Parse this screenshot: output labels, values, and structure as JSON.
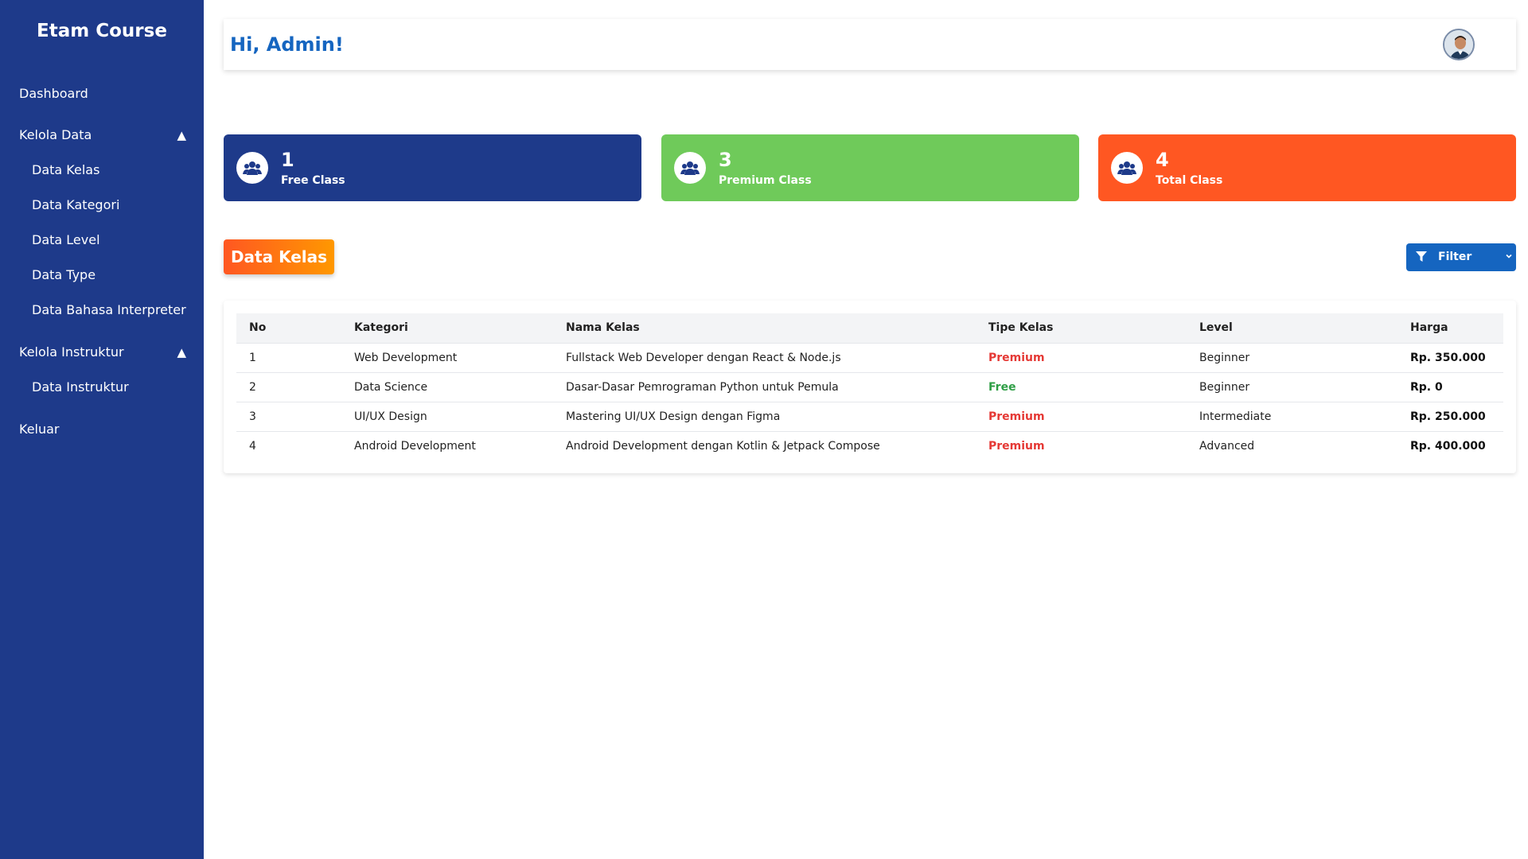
{
  "sidebar": {
    "brand": "Etam Course",
    "dashboard": "Dashboard",
    "kelola_data": {
      "label": "Kelola Data",
      "items": [
        "Data Kelas",
        "Data Kategori",
        "Data Level",
        "Data Type",
        "Data Bahasa Interpreter"
      ]
    },
    "kelola_instruktur": {
      "label": "Kelola Instruktur",
      "items": [
        "Data Instruktur"
      ]
    },
    "logout": "Keluar",
    "caret": "▲"
  },
  "header": {
    "greeting": "Hi, Admin!",
    "avatar_icon": "user-avatar"
  },
  "stats": [
    {
      "value": "1",
      "label": "Free Class",
      "color": "#1e3a8a",
      "icon": "users-icon"
    },
    {
      "value": "3",
      "label": "Premium Class",
      "color": "#6fca5a",
      "icon": "users-icon"
    },
    {
      "value": "4",
      "label": "Total Class",
      "color": "#ff5722",
      "icon": "users-icon"
    }
  ],
  "section": {
    "title": "Data Kelas"
  },
  "filter": {
    "label": "Filter",
    "icon": "filter-icon",
    "chevron": "⌄"
  },
  "table": {
    "headers": [
      "No",
      "Kategori",
      "Nama Kelas",
      "Tipe Kelas",
      "Level",
      "Harga"
    ],
    "rows": [
      {
        "no": "1",
        "kategori": "Web Development",
        "nama": "Fullstack Web Developer dengan React & Node.js",
        "tipe": "Premium",
        "level": "Beginner",
        "harga": "Rp. 350.000"
      },
      {
        "no": "2",
        "kategori": "Data Science",
        "nama": "Dasar-Dasar Pemrograman Python untuk Pemula",
        "tipe": "Free",
        "level": "Beginner",
        "harga": "Rp. 0"
      },
      {
        "no": "3",
        "kategori": "UI/UX Design",
        "nama": "Mastering UI/UX Design dengan Figma",
        "tipe": "Premium",
        "level": "Intermediate",
        "harga": "Rp. 250.000"
      },
      {
        "no": "4",
        "kategori": "Android Development",
        "nama": "Android Development dengan Kotlin & Jetpack Compose",
        "tipe": "Premium",
        "level": "Advanced",
        "harga": "Rp. 400.000"
      }
    ]
  },
  "colors": {
    "sidebar_bg": "#1e3a8a",
    "accent_blue": "#1565c0",
    "premium_red": "#e53935",
    "free_green": "#2e9e45"
  }
}
